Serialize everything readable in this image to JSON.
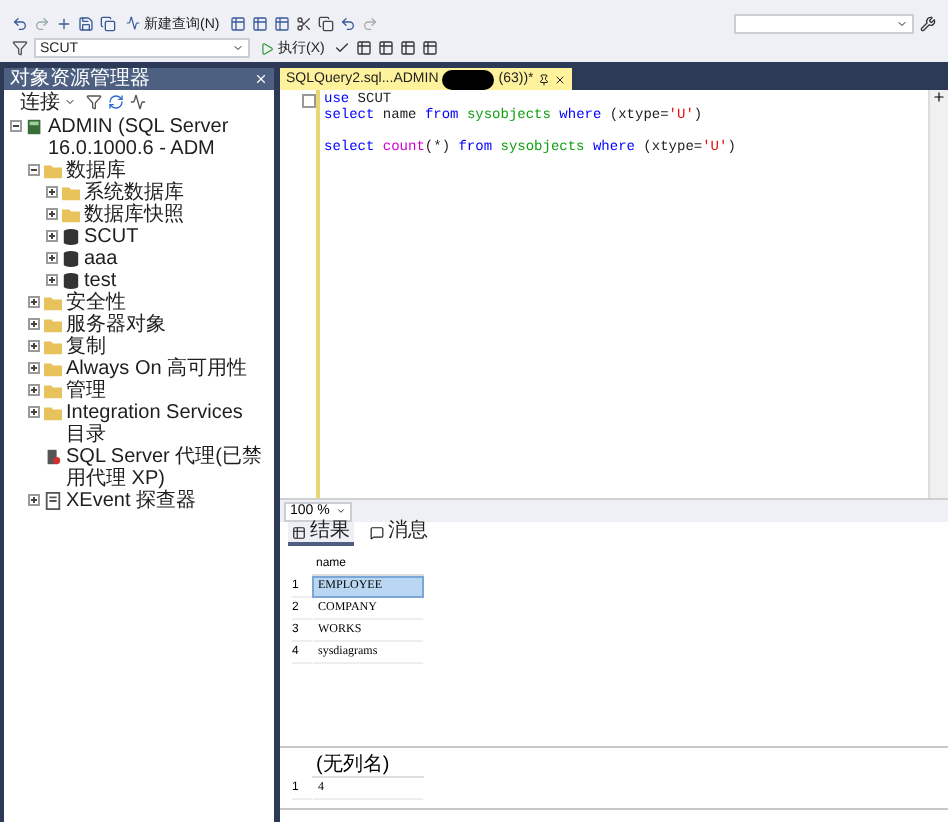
{
  "toolbar": {
    "new_query": "新建查询(N)",
    "database": "SCUT",
    "execute": "执行(X)"
  },
  "object_explorer": {
    "title": "对象资源管理器",
    "connect": "连接",
    "tree": [
      {
        "label": "ADMIN (SQL Server 16.0.1000.6 - ADM",
        "kind": "server",
        "expanded": true,
        "children": [
          {
            "label": "数据库",
            "kind": "folder",
            "expanded": true,
            "children": [
              {
                "label": "系统数据库",
                "kind": "folder",
                "expanded": false
              },
              {
                "label": "数据库快照",
                "kind": "folder",
                "expanded": false
              },
              {
                "label": "SCUT",
                "kind": "database",
                "expanded": false
              },
              {
                "label": "aaa",
                "kind": "database",
                "expanded": false
              },
              {
                "label": "test",
                "kind": "database",
                "expanded": false
              }
            ]
          },
          {
            "label": "安全性",
            "kind": "folder",
            "expanded": false
          },
          {
            "label": "服务器对象",
            "kind": "folder",
            "expanded": false
          },
          {
            "label": "复制",
            "kind": "folder",
            "expanded": false
          },
          {
            "label": "Always On 高可用性",
            "kind": "folder",
            "expanded": false
          },
          {
            "label": "管理",
            "kind": "folder",
            "expanded": false
          },
          {
            "label": "Integration Services 目录",
            "kind": "folder",
            "expanded": false
          },
          {
            "label": "SQL Server 代理(已禁用代理 XP)",
            "kind": "agent"
          },
          {
            "label": "XEvent 探查器",
            "kind": "xevent",
            "expanded": false
          }
        ]
      }
    ]
  },
  "editor": {
    "tab": {
      "title": "SQLQuery2.sql...ADMIN",
      "suffix": "(63))*"
    },
    "lines": [
      {
        "kind": "code",
        "tokens": [
          {
            "kind": "keyword",
            "text": "use"
          },
          {
            "kind": "plain",
            "text": " SCUT"
          }
        ]
      },
      {
        "kind": "code",
        "tokens": [
          {
            "kind": "keyword",
            "text": "select"
          },
          {
            "kind": "plain",
            "text": " name "
          },
          {
            "kind": "keyword",
            "text": "from "
          },
          {
            "kind": "object",
            "text": "sysobjects"
          },
          {
            "kind": "keyword",
            "text": " where"
          },
          {
            "kind": "plain",
            "text": " (xtype="
          },
          {
            "kind": "string",
            "text": "'U'"
          },
          {
            "kind": "plain",
            "text": ")"
          }
        ]
      },
      {
        "kind": "blank"
      },
      {
        "kind": "code",
        "tokens": [
          {
            "kind": "keyword",
            "text": "select "
          },
          {
            "kind": "function",
            "text": "count"
          },
          {
            "kind": "plain",
            "text": "(*) "
          },
          {
            "kind": "keyword",
            "text": "from "
          },
          {
            "kind": "object",
            "text": "sysobjects"
          },
          {
            "kind": "keyword",
            "text": " where"
          },
          {
            "kind": "plain",
            "text": " (xtype="
          },
          {
            "kind": "string",
            "text": "'U'"
          },
          {
            "kind": "plain",
            "text": ")"
          }
        ]
      }
    ],
    "zoom": "100 %"
  },
  "results": {
    "tabs": [
      {
        "label": "结果",
        "selected": true
      },
      {
        "label": "消息",
        "selected": false
      }
    ],
    "grids": [
      {
        "column": "name",
        "rows": [
          {
            "number": "1",
            "value": "EMPLOYEE",
            "selected": true
          },
          {
            "number": "2",
            "value": "COMPANY",
            "selected": false
          },
          {
            "number": "3",
            "value": "WORKS",
            "selected": false
          },
          {
            "number": "4",
            "value": "sysdiagrams",
            "selected": false
          }
        ]
      },
      {
        "column": "(无列名)",
        "rows": [
          {
            "number": "1",
            "value": "4",
            "selected": false
          }
        ]
      }
    ]
  }
}
